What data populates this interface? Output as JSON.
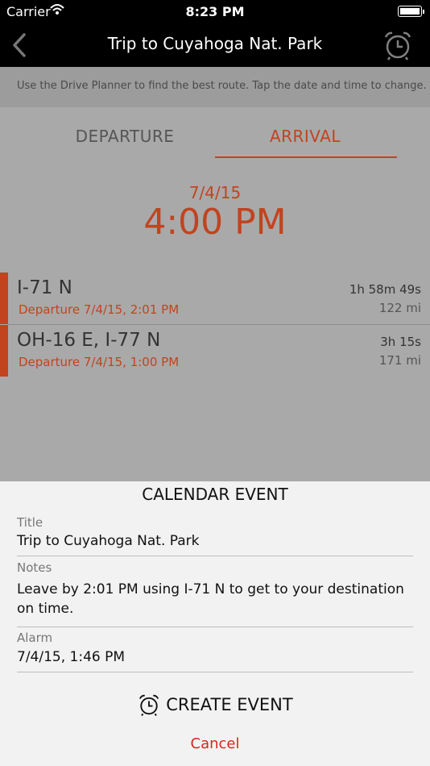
{
  "status": {
    "carrier": "Carrier",
    "time": "8:23 PM"
  },
  "nav": {
    "title": "Trip to Cuyahoga Nat. Park"
  },
  "info": {
    "text": "Use the Drive Planner to find the best route. Tap the date and time to change."
  },
  "tabs": {
    "departure": "DEPARTURE",
    "arrival": "ARRIVAL"
  },
  "arrival": {
    "date": "7/4/15",
    "time": "4:00 PM"
  },
  "routes": [
    {
      "name": "I-71 N",
      "departure": "Departure 7/4/15, 2:01 PM",
      "duration": "1h 58m 49s",
      "distance": "122 mi"
    },
    {
      "name": "OH-16 E, I-77 N",
      "departure": "Departure 7/4/15, 1:00 PM",
      "duration": "3h 15s",
      "distance": "171 mi"
    }
  ],
  "event": {
    "heading": "CALENDAR EVENT",
    "title_label": "Title",
    "title_value": "Trip to Cuyahoga Nat. Park",
    "notes_label": "Notes",
    "notes_value": "Leave by 2:01 PM using I-71 N to get to your destination on time.",
    "alarm_label": "Alarm",
    "alarm_value": "7/4/15, 1:46 PM",
    "create_label": "CREATE EVENT",
    "cancel_label": "Cancel"
  },
  "colors": {
    "accent": "#c1441f",
    "cancel": "#d9251d"
  }
}
